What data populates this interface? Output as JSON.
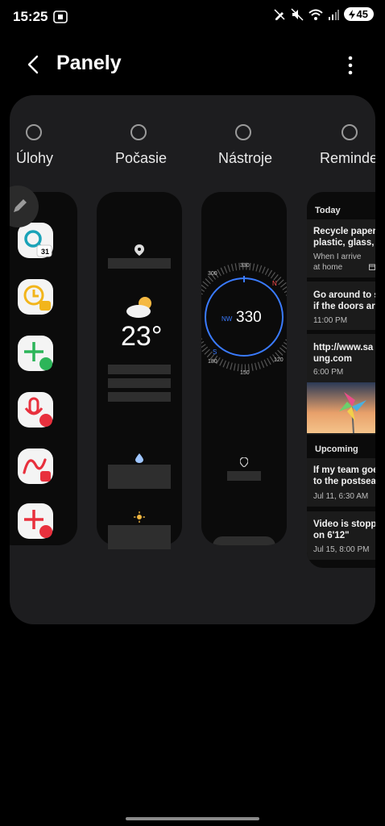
{
  "status_bar": {
    "time": "15:25",
    "battery": "45"
  },
  "header": {
    "title": "Panely"
  },
  "panels": [
    {
      "label": "Úlohy"
    },
    {
      "label": "Počasie"
    },
    {
      "label": "Nástroje"
    },
    {
      "label": "Reminde"
    }
  ],
  "tasks_panel": {
    "calendar_badge": "31",
    "icons": [
      "calendar-search-icon",
      "reminder-clock-icon",
      "add-contact-icon",
      "voice-record-icon",
      "drawing-icon",
      "add-contact-plus-icon"
    ]
  },
  "weather_panel": {
    "temperature": "23°"
  },
  "compass_panel": {
    "heading": "330",
    "direction": "NW",
    "ticks": [
      "330",
      "300",
      "N",
      "150",
      "180",
      "S",
      "120"
    ]
  },
  "reminder_panel": {
    "today_label": "Today",
    "upcoming_label": "Upcoming",
    "cards": [
      {
        "line1": "Recycle paper,",
        "line2": "plastic, glass, m",
        "sub1": "When I arrive",
        "sub2": "at home"
      },
      {
        "line1": "Go around to se",
        "line2": "if the doors are",
        "sub1": "11:00 PM"
      },
      {
        "line1": "http://www.sa",
        "line2": "ung.com",
        "sub1": "6:00 PM"
      },
      {
        "line1": "If my team goes",
        "line2": "to the postseas",
        "sub1": "Jul 11, 6:30 AM"
      },
      {
        "line1": "Video is stoppe",
        "line2": "on 6'12\"",
        "sub1": "Jul 15, 8:00 PM"
      }
    ]
  },
  "colors": {
    "accent_blue": "#3a7bff",
    "compass_red": "#ff4b4b"
  }
}
